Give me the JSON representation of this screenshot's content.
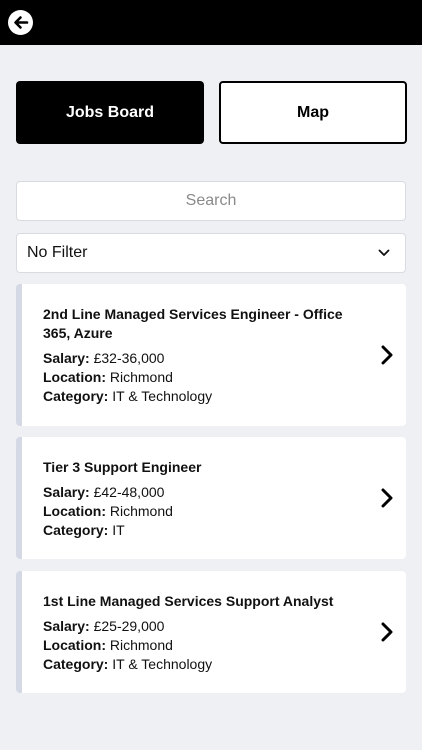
{
  "header": {
    "back_icon": "arrow-left-circle-icon"
  },
  "tabs": [
    {
      "label": "Jobs Board",
      "active": true
    },
    {
      "label": "Map",
      "active": false
    }
  ],
  "search": {
    "placeholder": "Search",
    "value": ""
  },
  "filter": {
    "selected": "No Filter",
    "icon": "chevron-down-icon"
  },
  "labels": {
    "salary": "Salary:",
    "location": "Location:",
    "category": "Category:"
  },
  "jobs": [
    {
      "title": "2nd Line Managed Services Engineer - Office 365, Azure",
      "salary": "£32-36,000",
      "location": "Richmond",
      "category": "IT & Technology"
    },
    {
      "title": "Tier 3 Support Engineer",
      "salary": "£42-48,000",
      "location": "Richmond",
      "category": "IT"
    },
    {
      "title": "1st Line Managed Services Support Analyst",
      "salary": "£25-29,000",
      "location": "Richmond",
      "category": "IT & Technology"
    }
  ],
  "colors": {
    "background": "#eef0f4",
    "topbar": "#000000",
    "card_accent": "#d5d9e6"
  }
}
